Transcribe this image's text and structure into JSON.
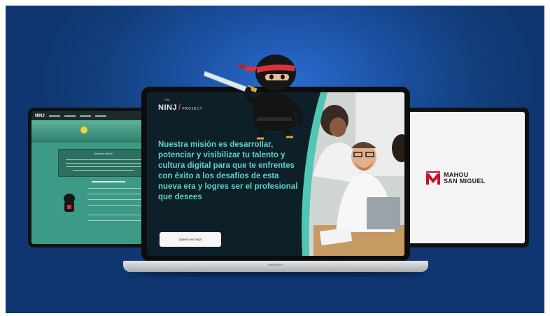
{
  "left_site": {
    "logo": "NINJ",
    "box_title": "Nuestra misión"
  },
  "laptop": {
    "brand_top": "THE",
    "brand_main": "NINJ",
    "brand_tail": "PROJECT",
    "headline": "Nuestra misión es desarrollar, potenciar y visibilizar tu talento y cultura digital para que te enfrentes con éxito a los desafíos de esta nueva era y logres ser el profesional que desees",
    "cta_label": "Quiero ser ninja",
    "base_label": "MacBook Pro"
  },
  "right_site": {
    "logo_line1": "MAHOU",
    "logo_line2": "SAN MIGUEL"
  },
  "colors": {
    "background": "#123f7d",
    "accent_teal": "#5fd4c2",
    "mahou_red": "#c8102e",
    "left_site_green": "#3d9a86"
  }
}
